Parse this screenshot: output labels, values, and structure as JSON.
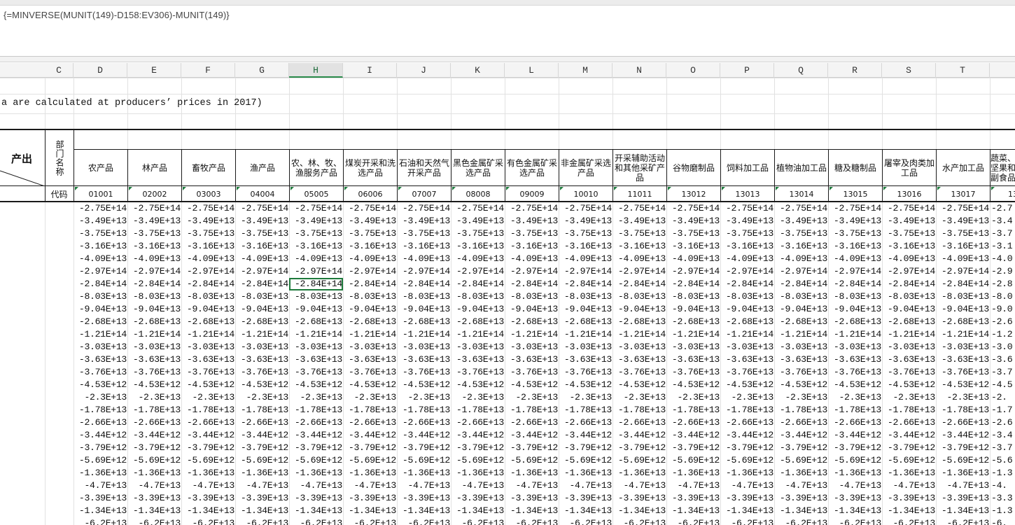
{
  "formula_bar": {
    "text": "{=MINVERSE(MUNIT(149)-D158:EV306)-MUNIT(149)}"
  },
  "column_headers": [
    "C",
    "D",
    "E",
    "F",
    "G",
    "H",
    "I",
    "J",
    "K",
    "L",
    "M",
    "N",
    "O",
    "P",
    "Q",
    "R",
    "S",
    "T"
  ],
  "selected_column": "H",
  "note_text": "a are calculated at producers’ prices in 2017)",
  "header": {
    "corner_label": "产出",
    "dept_label": "部门名称",
    "code_label": "代码"
  },
  "sectors": [
    {
      "name": "农产品",
      "code": "01001"
    },
    {
      "name": "林产品",
      "code": "02002"
    },
    {
      "name": "畜牧产品",
      "code": "03003"
    },
    {
      "name": "渔产品",
      "code": "04004"
    },
    {
      "name": "农、林、牧、渔服务产品",
      "code": "05005"
    },
    {
      "name": "煤炭开采和洗选产品",
      "code": "06006"
    },
    {
      "name": "石油和天然气开采产品",
      "code": "07007"
    },
    {
      "name": "黑色金属矿采选产品",
      "code": "08008"
    },
    {
      "name": "有色金属矿采选产品",
      "code": "09009"
    },
    {
      "name": "非金属矿采选产品",
      "code": "10010"
    },
    {
      "name": "开采辅助活动和其他采矿产品",
      "code": "11011"
    },
    {
      "name": "谷物磨制品",
      "code": "13012"
    },
    {
      "name": "饲料加工品",
      "code": "13013"
    },
    {
      "name": "植物油加工品",
      "code": "13014"
    },
    {
      "name": "糖及糖制品",
      "code": "13015"
    },
    {
      "name": "屠宰及肉类加工品",
      "code": "13016"
    },
    {
      "name": "水产加工品",
      "code": "13017"
    },
    {
      "name": "蔬菜、坚果和副食品",
      "code": "13"
    }
  ],
  "data_rows": [
    "-2.75E+14",
    "-3.49E+13",
    "-3.75E+13",
    "-3.16E+13",
    "-4.09E+13",
    "-2.97E+14",
    "-2.84E+14",
    "-8.03E+13",
    "-9.04E+13",
    "-2.68E+13",
    "-1.21E+14",
    "-3.03E+13",
    "-3.63E+13",
    "-3.76E+13",
    "-4.53E+12",
    "-2.3E+13",
    "-1.78E+13",
    "-2.66E+13",
    "-3.44E+12",
    "-3.79E+12",
    "-5.69E+12",
    "-1.36E+13",
    "-4.7E+13",
    "-3.39E+13",
    "-1.34E+13",
    "-6.2E+13"
  ],
  "last_col_partial": [
    "-2.7",
    "-3.4",
    "-3.7",
    "-3.1",
    "-4.0",
    "-2.9",
    "-2.8",
    "-8.0",
    "-9.0",
    "-2.6",
    "-1.2",
    "-3.0",
    "-3.6",
    "-3.7",
    "-4.5",
    "-2.",
    "-1.7",
    "-2.6",
    "-3.4",
    "-3.7",
    "-5.6",
    "-1.3",
    "-4.",
    "-3.3",
    "-1.3",
    "-6."
  ],
  "active_cell": {
    "row": 6,
    "col": "H"
  }
}
